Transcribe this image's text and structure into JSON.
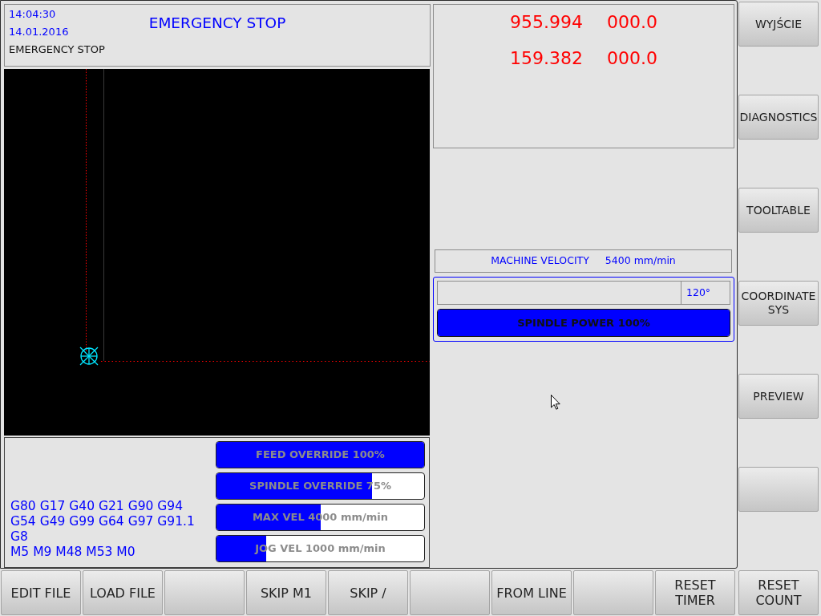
{
  "header": {
    "time": "14:04:30",
    "date": "14.01.2016",
    "status": "EMERGENCY STOP",
    "title": "EMERGENCY STOP"
  },
  "modal_codes": [
    "G80 G17 G40 G21 G90 G94",
    "G54 G49 G99 G64 G97 G91.1",
    "G8",
    "M5 M9 M48 M53 M0"
  ],
  "override_bars": [
    {
      "label": "FEED OVERRIDE 100%",
      "level": 1.0
    },
    {
      "label": "SPINDLE OVERRIDE 75%",
      "level": 0.75
    },
    {
      "label": "MAX VEL 4000 mm/min",
      "level": 0.5
    },
    {
      "label": "JOG VEL 1000 mm/min",
      "level": 0.24
    }
  ],
  "dro_rows": [
    [
      "955.994",
      "000.0"
    ],
    [
      "159.382",
      "000.0"
    ]
  ],
  "machine_velocity": {
    "label": "MACHINE VELOCITY",
    "value": "5400 mm/min"
  },
  "spindle": {
    "angle": "120°",
    "power_bar": {
      "label": "SPINDLE POWER 100%",
      "level": 1.0
    }
  },
  "side_buttons": [
    {
      "kind": "command",
      "label": "WYJŚCIE"
    },
    {
      "kind": "command",
      "label": "DIAGNOSTICS"
    },
    {
      "kind": "command",
      "label": "TOOLTABLE"
    },
    {
      "kind": "command",
      "label": "COORDINATE SYS"
    },
    {
      "kind": "command",
      "label": "PREVIEW"
    },
    {
      "kind": "blank"
    }
  ],
  "bottom_buttons": [
    {
      "kind": "command",
      "label": "EDIT FILE"
    },
    {
      "kind": "command",
      "label": "LOAD FILE"
    },
    {
      "kind": "blank"
    },
    {
      "kind": "command",
      "label": "SKIP M1"
    },
    {
      "kind": "command",
      "label": "SKIP /"
    },
    {
      "kind": "blank"
    },
    {
      "kind": "command",
      "label": "FROM LINE"
    },
    {
      "kind": "blank"
    },
    {
      "kind": "command",
      "label": "RESET TIMER"
    },
    {
      "kind": "command",
      "label": "RESET COUNT"
    }
  ]
}
